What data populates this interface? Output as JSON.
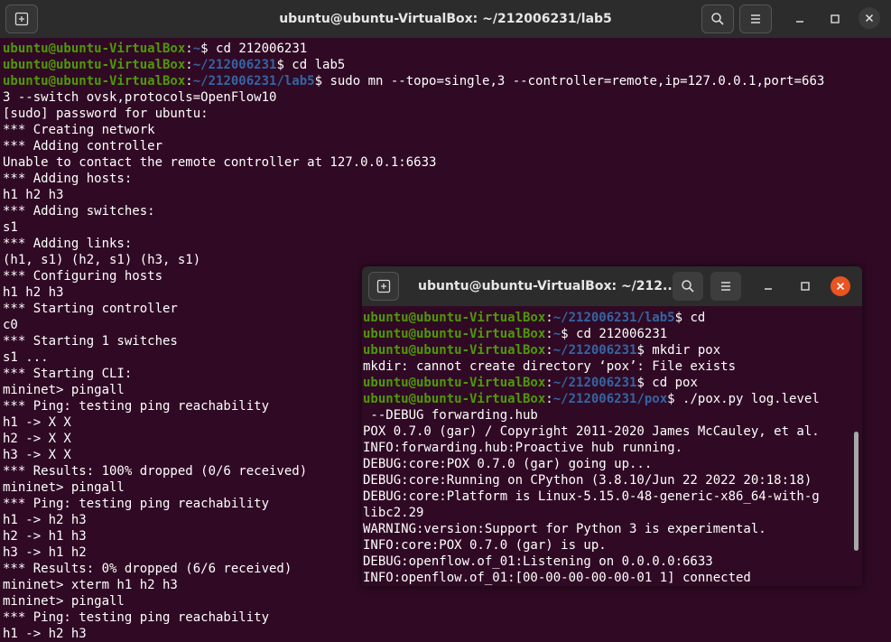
{
  "main_window": {
    "title": "ubuntu@ubuntu-VirtualBox: ~/212006231/lab5",
    "lines": [
      [
        {
          "t": "ubuntu@ubuntu-VirtualBox",
          "c": "u"
        },
        {
          "t": ":"
        },
        {
          "t": "~",
          "c": "p"
        },
        {
          "t": "$ cd 212006231"
        }
      ],
      [
        {
          "t": "ubuntu@ubuntu-VirtualBox",
          "c": "u"
        },
        {
          "t": ":"
        },
        {
          "t": "~/212006231",
          "c": "p"
        },
        {
          "t": "$ cd lab5"
        }
      ],
      [
        {
          "t": "ubuntu@ubuntu-VirtualBox",
          "c": "u"
        },
        {
          "t": ":"
        },
        {
          "t": "~/212006231/lab5",
          "c": "p"
        },
        {
          "t": "$ sudo mn --topo=single,3 --controller=remote,ip=127.0.0.1,port=663"
        }
      ],
      [
        {
          "t": "3 --switch ovsk,protocols=OpenFlow10"
        }
      ],
      [
        {
          "t": "[sudo] password for ubuntu:"
        }
      ],
      [
        {
          "t": "*** Creating network"
        }
      ],
      [
        {
          "t": "*** Adding controller"
        }
      ],
      [
        {
          "t": "Unable to contact the remote controller at 127.0.0.1:6633"
        }
      ],
      [
        {
          "t": "*** Adding hosts:"
        }
      ],
      [
        {
          "t": "h1 h2 h3"
        }
      ],
      [
        {
          "t": "*** Adding switches:"
        }
      ],
      [
        {
          "t": "s1"
        }
      ],
      [
        {
          "t": "*** Adding links:"
        }
      ],
      [
        {
          "t": "(h1, s1) (h2, s1) (h3, s1)"
        }
      ],
      [
        {
          "t": "*** Configuring hosts"
        }
      ],
      [
        {
          "t": "h1 h2 h3"
        }
      ],
      [
        {
          "t": "*** Starting controller"
        }
      ],
      [
        {
          "t": "c0"
        }
      ],
      [
        {
          "t": "*** Starting 1 switches"
        }
      ],
      [
        {
          "t": "s1 ..."
        }
      ],
      [
        {
          "t": "*** Starting CLI:"
        }
      ],
      [
        {
          "t": "mininet> pingall"
        }
      ],
      [
        {
          "t": "*** Ping: testing ping reachability"
        }
      ],
      [
        {
          "t": "h1 -> X X"
        }
      ],
      [
        {
          "t": "h2 -> X X"
        }
      ],
      [
        {
          "t": "h3 -> X X"
        }
      ],
      [
        {
          "t": "*** Results: 100% dropped (0/6 received)"
        }
      ],
      [
        {
          "t": "mininet> pingall"
        }
      ],
      [
        {
          "t": "*** Ping: testing ping reachability"
        }
      ],
      [
        {
          "t": "h1 -> h2 h3"
        }
      ],
      [
        {
          "t": "h2 -> h1 h3"
        }
      ],
      [
        {
          "t": "h3 -> h1 h2"
        }
      ],
      [
        {
          "t": "*** Results: 0% dropped (6/6 received)"
        }
      ],
      [
        {
          "t": "mininet> xterm h1 h2 h3"
        }
      ],
      [
        {
          "t": "mininet> pingall"
        }
      ],
      [
        {
          "t": "*** Ping: testing ping reachability"
        }
      ],
      [
        {
          "t": "h1 -> h2 h3"
        }
      ]
    ]
  },
  "pox_window": {
    "title": "ubuntu@ubuntu-VirtualBox: ~/212...",
    "lines": [
      [
        {
          "t": "ubuntu@ubuntu-VirtualBox",
          "c": "u"
        },
        {
          "t": ":"
        },
        {
          "t": "~/212006231/lab5",
          "c": "p"
        },
        {
          "t": "$ cd"
        }
      ],
      [
        {
          "t": "ubuntu@ubuntu-VirtualBox",
          "c": "u"
        },
        {
          "t": ":"
        },
        {
          "t": "~",
          "c": "p"
        },
        {
          "t": "$ cd 212006231"
        }
      ],
      [
        {
          "t": "ubuntu@ubuntu-VirtualBox",
          "c": "u"
        },
        {
          "t": ":"
        },
        {
          "t": "~/212006231",
          "c": "p"
        },
        {
          "t": "$ mkdir pox"
        }
      ],
      [
        {
          "t": "mkdir: cannot create directory ‘pox’: File exists"
        }
      ],
      [
        {
          "t": "ubuntu@ubuntu-VirtualBox",
          "c": "u"
        },
        {
          "t": ":"
        },
        {
          "t": "~/212006231",
          "c": "p"
        },
        {
          "t": "$ cd pox"
        }
      ],
      [
        {
          "t": "ubuntu@ubuntu-VirtualBox",
          "c": "u"
        },
        {
          "t": ":"
        },
        {
          "t": "~/212006231/pox",
          "c": "p"
        },
        {
          "t": "$ ./pox.py log.level"
        }
      ],
      [
        {
          "t": " --DEBUG forwarding.hub"
        }
      ],
      [
        {
          "t": "POX 0.7.0 (gar) / Copyright 2011-2020 James McCauley, et al."
        }
      ],
      [
        {
          "t": "INFO:forwarding.hub:Proactive hub running."
        }
      ],
      [
        {
          "t": "DEBUG:core:POX 0.7.0 (gar) going up..."
        }
      ],
      [
        {
          "t": "DEBUG:core:Running on CPython (3.8.10/Jun 22 2022 20:18:18)"
        }
      ],
      [
        {
          "t": "DEBUG:core:Platform is Linux-5.15.0-48-generic-x86_64-with-g"
        }
      ],
      [
        {
          "t": "libc2.29"
        }
      ],
      [
        {
          "t": "WARNING:version:Support for Python 3 is experimental."
        }
      ],
      [
        {
          "t": "INFO:core:POX 0.7.0 (gar) is up."
        }
      ],
      [
        {
          "t": "DEBUG:openflow.of_01:Listening on 0.0.0.0:6633"
        }
      ],
      [
        {
          "t": "INFO:openflow.of_01:[00-00-00-00-00-01 1] connected"
        }
      ]
    ]
  },
  "icons": [
    "new-tab-icon",
    "search-icon",
    "menu-icon",
    "minimize-icon",
    "maximize-icon",
    "close-icon"
  ],
  "colors": {
    "terminal_bg": "#300a24",
    "user_host": "#4e9a06",
    "path": "#3465a4",
    "close_button": "#e95420",
    "titlebar": "#2c2c2c"
  }
}
